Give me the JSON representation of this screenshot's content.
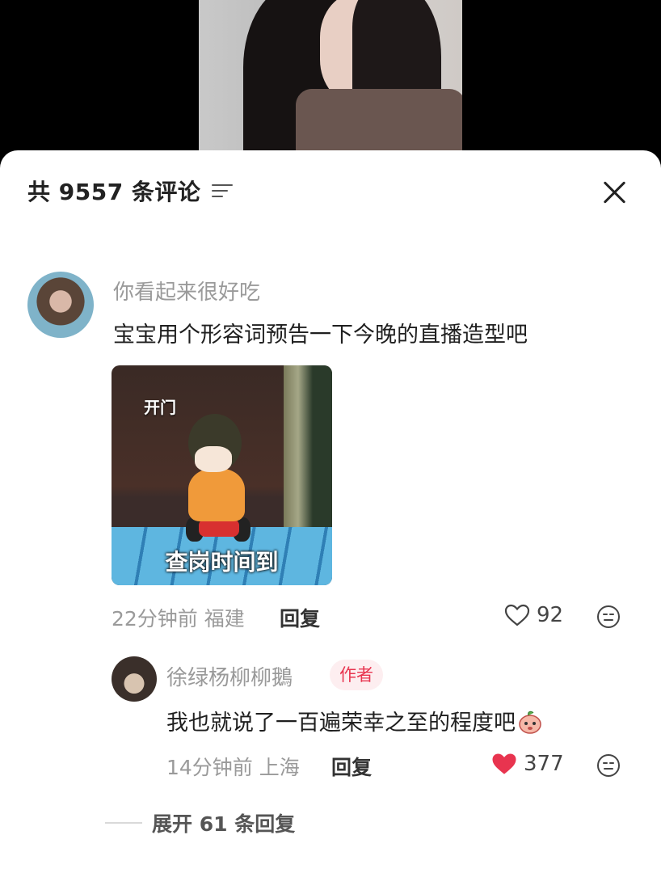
{
  "header": {
    "comment_count_label": "共 9557 条评论"
  },
  "comment": {
    "username": "你看起来很好吃",
    "text": "宝宝用个形容词预告一下今晚的直播造型吧",
    "sticker": {
      "caption_top": "开门",
      "caption_bottom": "查岗时间到"
    },
    "time": "22分钟前",
    "location": "福建",
    "reply_label": "回复",
    "like_count": "92",
    "liked": false
  },
  "reply": {
    "username": "徐绿杨柳柳鵝",
    "badge": "作者",
    "text": "我也就说了一百遍荣幸之至的程度吧",
    "time": "14分钟前",
    "location": "上海",
    "reply_label": "回复",
    "like_count": "377",
    "liked": true
  },
  "expand_label": "展开 61 条回复",
  "colors": {
    "like_active": "#e8344f",
    "badge_bg": "#fdeef0",
    "badge_text": "#e8344f"
  }
}
